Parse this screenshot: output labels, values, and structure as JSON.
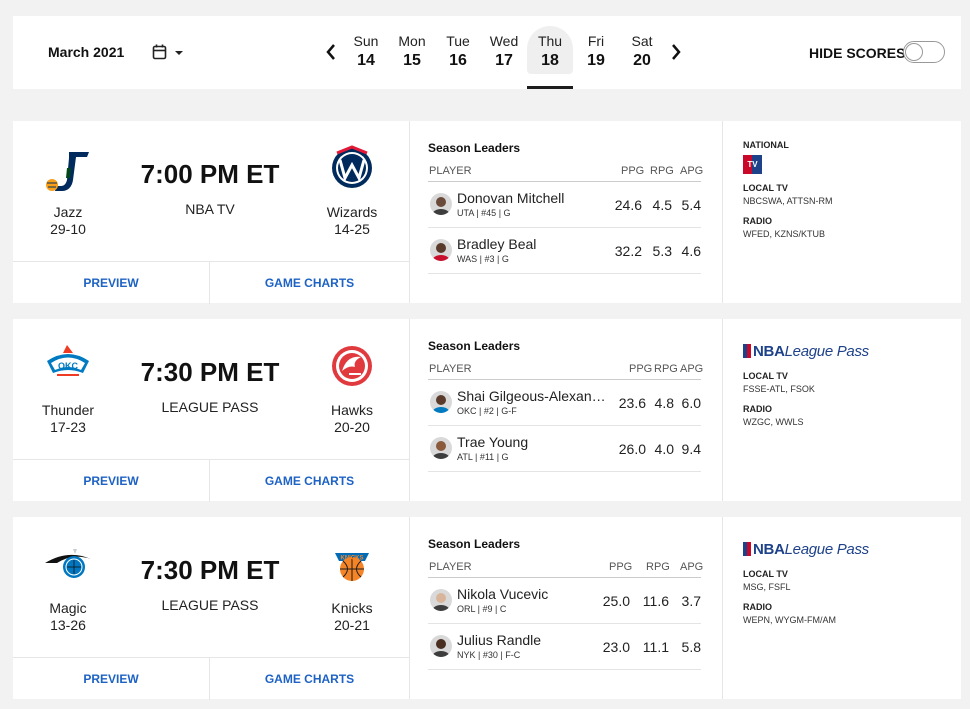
{
  "header": {
    "month": "March 2021",
    "days": [
      {
        "name": "Sun",
        "date": "14"
      },
      {
        "name": "Mon",
        "date": "15"
      },
      {
        "name": "Tue",
        "date": "16"
      },
      {
        "name": "Wed",
        "date": "17"
      },
      {
        "name": "Thu",
        "date": "18",
        "selected": true
      },
      {
        "name": "Fri",
        "date": "19"
      },
      {
        "name": "Sat",
        "date": "20"
      }
    ],
    "hide_scores": "HIDE SCORES",
    "hide_scores_on": false
  },
  "columns": {
    "player": "PLAYER",
    "ppg": "PPG",
    "rpg": "RPG",
    "apg": "APG"
  },
  "games": [
    {
      "away": {
        "name": "Jazz",
        "record": "29-10",
        "logo": "jazz-logo"
      },
      "home": {
        "name": "Wizards",
        "record": "14-25",
        "logo": "wizards-logo"
      },
      "time": "7:00 PM ET",
      "network": "NBA TV",
      "preview": "PREVIEW",
      "charts": "GAME CHARTS",
      "leaders_title": "Season Leaders",
      "leaders": [
        {
          "name": "Donovan Mitchell",
          "meta": "UTA | #45 | G",
          "ppg": "24.6",
          "rpg": "4.5",
          "apg": "5.4"
        },
        {
          "name": "Bradley Beal",
          "meta": "WAS | #3 | G",
          "ppg": "32.2",
          "rpg": "5.3",
          "apg": "4.6"
        }
      ],
      "broadcast": {
        "national_label": "NATIONAL",
        "national_logo": "TV",
        "local_label": "LOCAL TV",
        "local": "NBCSWA,  ATTSN-RM",
        "radio_label": "RADIO",
        "radio": "WFED,  KZNS/KTUB"
      }
    },
    {
      "away": {
        "name": "Thunder",
        "record": "17-23",
        "logo": "thunder-logo"
      },
      "home": {
        "name": "Hawks",
        "record": "20-20",
        "logo": "hawks-logo"
      },
      "time": "7:30 PM ET",
      "network": "LEAGUE PASS",
      "preview": "PREVIEW",
      "charts": "GAME CHARTS",
      "leaders_title": "Season Leaders",
      "leaders": [
        {
          "name": "Shai Gilgeous-Alexander",
          "meta": "OKC | #2 | G-F",
          "ppg": "23.6",
          "rpg": "4.8",
          "apg": "6.0"
        },
        {
          "name": "Trae Young",
          "meta": "ATL | #11 | G",
          "ppg": "26.0",
          "rpg": "4.0",
          "apg": "9.4"
        }
      ],
      "broadcast": {
        "league_pass": "League Pass",
        "league_pass_prefix": "NBA",
        "local_label": "LOCAL TV",
        "local": "FSSE-ATL,  FSOK",
        "radio_label": "RADIO",
        "radio": "WZGC,  WWLS"
      }
    },
    {
      "away": {
        "name": "Magic",
        "record": "13-26",
        "logo": "magic-logo"
      },
      "home": {
        "name": "Knicks",
        "record": "20-21",
        "logo": "knicks-logo"
      },
      "time": "7:30 PM ET",
      "network": "LEAGUE PASS",
      "preview": "PREVIEW",
      "charts": "GAME CHARTS",
      "leaders_title": "Season Leaders",
      "leaders": [
        {
          "name": "Nikola Vucevic",
          "meta": "ORL | #9 | C",
          "ppg": "25.0",
          "rpg": "11.6",
          "apg": "3.7"
        },
        {
          "name": "Julius Randle",
          "meta": "NYK | #30 | F-C",
          "ppg": "23.0",
          "rpg": "11.1",
          "apg": "5.8"
        }
      ],
      "broadcast": {
        "league_pass": "League Pass",
        "league_pass_prefix": "NBA",
        "local_label": "LOCAL TV",
        "local": "MSG,  FSFL",
        "radio_label": "RADIO",
        "radio": "WEPN,  WYGM-FM/AM"
      }
    }
  ]
}
